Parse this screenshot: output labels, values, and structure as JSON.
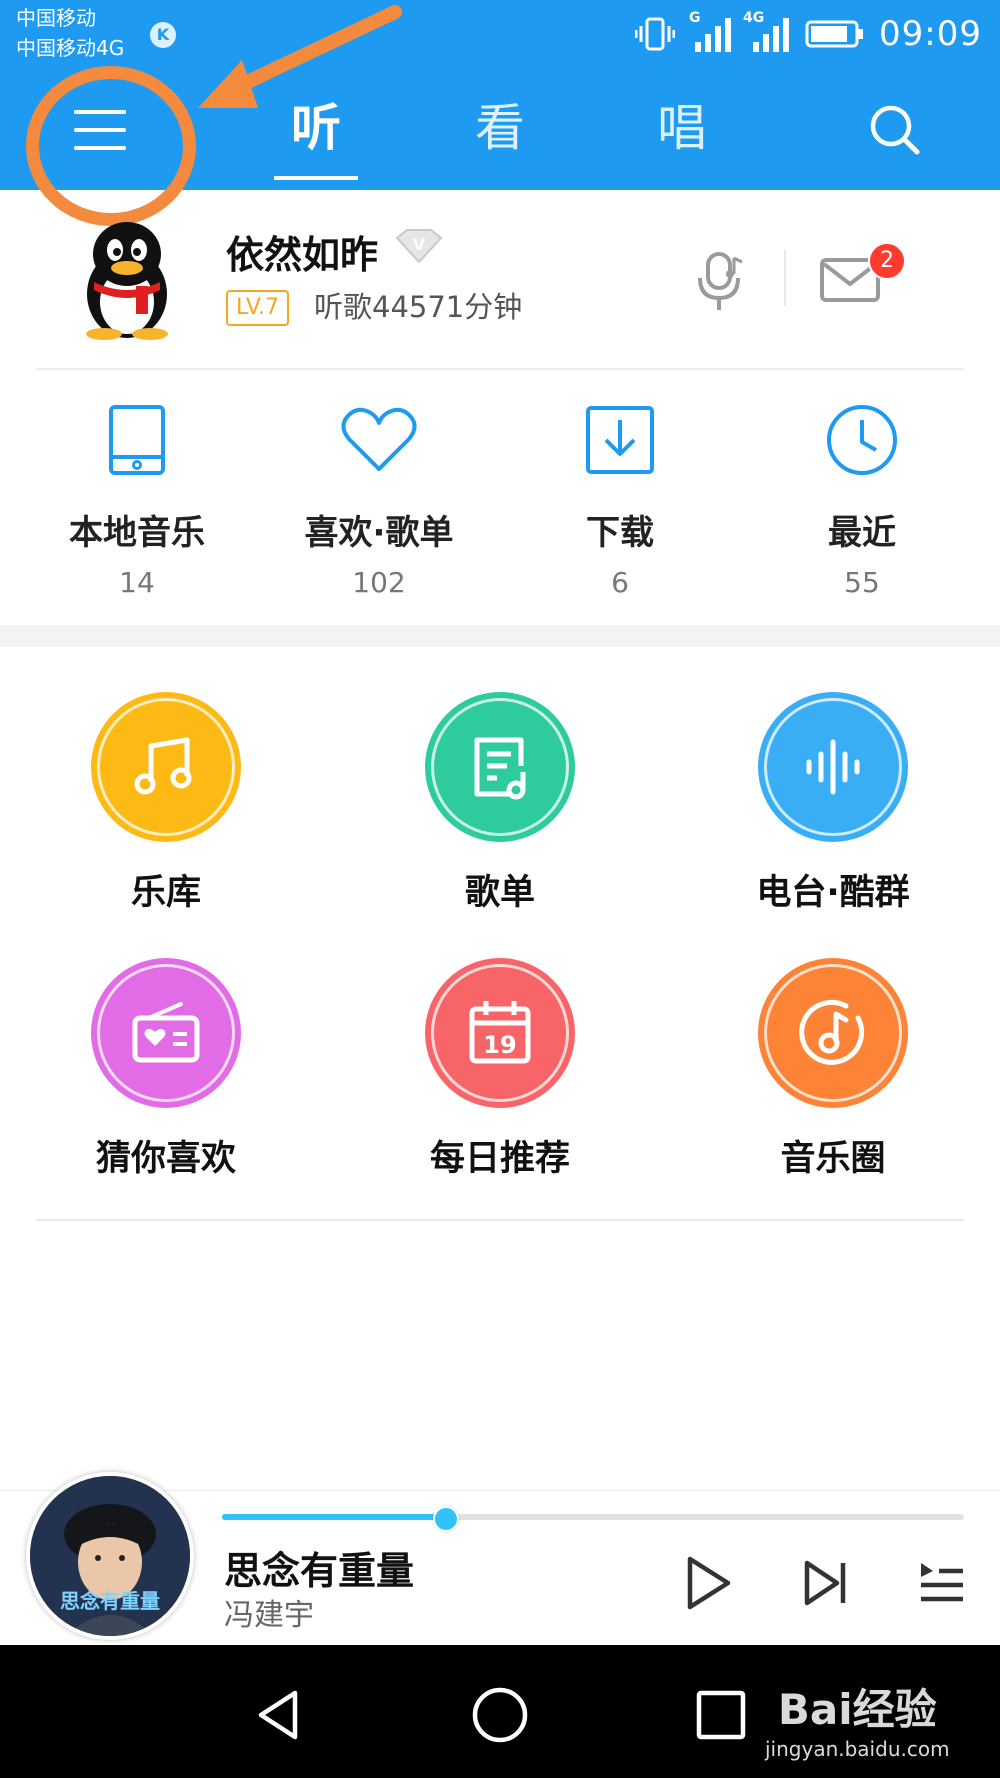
{
  "status_bar": {
    "carrier1": "中国移动",
    "carrier2": "中国移动4G",
    "net_label_1": "G",
    "net_label_2": "4G",
    "time": "09:09"
  },
  "header": {
    "tabs": [
      {
        "label": "听",
        "active": true
      },
      {
        "label": "看",
        "active": false
      },
      {
        "label": "唱",
        "active": false
      }
    ]
  },
  "profile": {
    "username": "依然如昨",
    "vip_letter": "V",
    "level": "LV.7",
    "listen_time": "听歌44571分钟",
    "mail_badge": "2"
  },
  "quick_access": [
    {
      "label": "本地音乐",
      "count": "14",
      "icon": "tablet-icon"
    },
    {
      "label": "喜欢·歌单",
      "count": "102",
      "icon": "heart-icon"
    },
    {
      "label": "下载",
      "count": "6",
      "icon": "download-icon"
    },
    {
      "label": "最近",
      "count": "55",
      "icon": "clock-icon"
    }
  ],
  "grid": [
    {
      "label": "乐库",
      "icon": "music-note-icon",
      "color": "#FDBA14"
    },
    {
      "label": "歌单",
      "icon": "playlist-icon",
      "color": "#2ECB9E"
    },
    {
      "label": "电台·酷群",
      "icon": "sound-wave-icon",
      "color": "#3AAEF4"
    },
    {
      "label": "猜你喜欢",
      "icon": "radio-icon",
      "color": "#E26BE6"
    },
    {
      "label": "每日推荐",
      "icon": "calendar-icon",
      "color": "#F86568",
      "day": "19"
    },
    {
      "label": "音乐圈",
      "icon": "music-circle-icon",
      "color": "#FD8336"
    }
  ],
  "player": {
    "title": "思念有重量",
    "artist": "冯建宇",
    "progress": 0.3,
    "album_text": "思念有重量"
  },
  "colors": {
    "header_blue": "#1E9BF0",
    "annotation_orange": "#F48A3E",
    "accent_cyan": "#31C3F7"
  },
  "watermark": {
    "brand": "Bai经验",
    "url": "jingyan.baidu.com"
  }
}
